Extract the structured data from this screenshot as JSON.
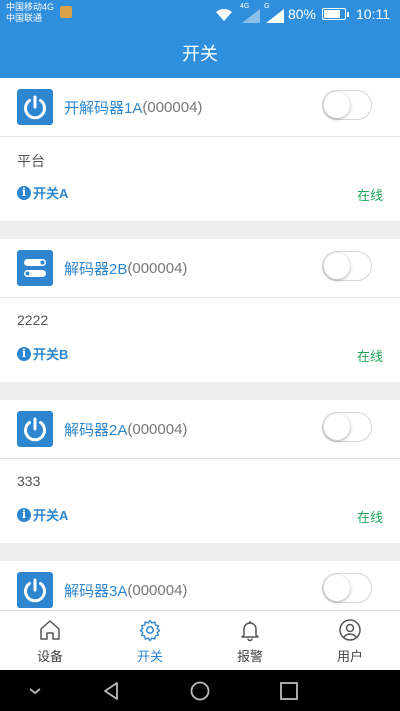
{
  "status_bar": {
    "carrier1": "中国移动4G",
    "carrier2": "中国联通",
    "battery": "80%",
    "time": "10:11",
    "net1": "4G",
    "net2": "G"
  },
  "header": {
    "title": "开关"
  },
  "devices": [
    {
      "icon": "power-icon",
      "name": "开解码器1A",
      "code": "(000004)",
      "platform": "平台",
      "switch": "开关A",
      "status": "在线",
      "on": false
    },
    {
      "icon": "toggle-switch-icon",
      "name": "解码器2B",
      "code": "(000004)",
      "platform": "2222",
      "switch": "开关B",
      "status": "在线",
      "on": false
    },
    {
      "icon": "power-icon",
      "name": "解码器2A",
      "code": "(000004)",
      "platform": "333",
      "switch": "开关A",
      "status": "在线",
      "on": false
    },
    {
      "icon": "power-icon",
      "name": "解码器3A",
      "code": "(000004)",
      "on": false
    }
  ],
  "tabs": [
    {
      "label": "设备",
      "icon": "home-icon",
      "active": false
    },
    {
      "label": "开关",
      "icon": "gear-icon",
      "active": true
    },
    {
      "label": "报警",
      "icon": "bell-icon",
      "active": false
    },
    {
      "label": "用户",
      "icon": "user-icon",
      "active": false
    }
  ],
  "colors": {
    "primary": "#2f8fdc",
    "accent": "#2d86cf",
    "online": "#1fa55c"
  }
}
